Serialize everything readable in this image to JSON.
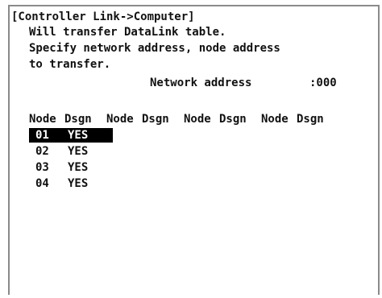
{
  "screen": {
    "title": "[Controller Link->Computer]",
    "description": [
      "Will transfer DataLink table.",
      "Specify network address, node address",
      "to transfer."
    ],
    "network_address_label": "Network address",
    "network_address_value": ":000"
  },
  "table": {
    "headers": [
      "Node",
      "Dsgn",
      "Node",
      "Dsgn",
      "Node",
      "Dsgn",
      "Node",
      "Dsgn"
    ],
    "rows": [
      {
        "node": "01",
        "dsgn": "YES",
        "selected": true
      },
      {
        "node": "02",
        "dsgn": "YES",
        "selected": false
      },
      {
        "node": "03",
        "dsgn": "YES",
        "selected": false
      },
      {
        "node": "04",
        "dsgn": "YES",
        "selected": false
      }
    ]
  },
  "colors": {
    "text": "#111111",
    "highlight_bg": "#000000",
    "highlight_text": "#ffffff",
    "border": "#8a8a8a"
  }
}
